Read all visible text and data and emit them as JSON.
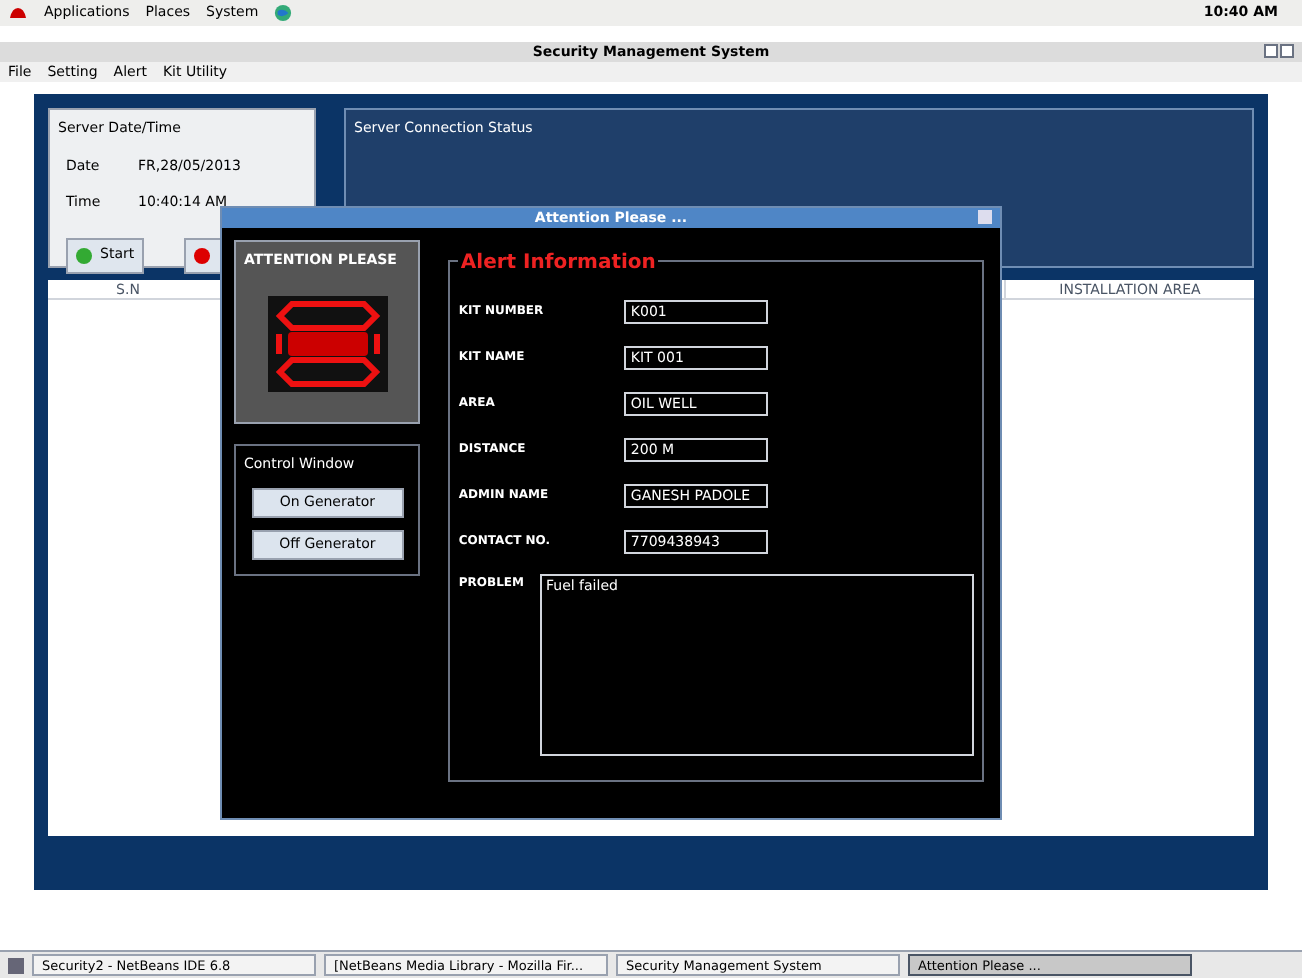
{
  "top_panel": {
    "menus": [
      "Applications",
      "Places",
      "System"
    ],
    "clock": "10:40 AM"
  },
  "window": {
    "title": "Security Management System",
    "menu": [
      "File",
      "Setting",
      "Alert",
      "Kit Utility"
    ]
  },
  "server_panel": {
    "title": "Server Date/Time",
    "rows": [
      {
        "label": "Date",
        "value": "FR,28/05/2013"
      },
      {
        "label": "Time",
        "value": "10:40:14 AM"
      }
    ],
    "start_button": "Start"
  },
  "connection_panel": {
    "title": "Server Connection Status"
  },
  "table": {
    "columns": [
      "S.N",
      "INSTALLATION AREA"
    ]
  },
  "dialog": {
    "title": "Attention Please ...",
    "alert_panel_title": "ATTENTION PLEASE",
    "control_title": "Control Window",
    "buttons": [
      "On Generator",
      "Off Generator"
    ],
    "info_title": "Alert Information",
    "fields": [
      {
        "label": "KIT NUMBER",
        "value": "K001"
      },
      {
        "label": "KIT NAME",
        "value": "KIT 001"
      },
      {
        "label": "AREA",
        "value": "OIL WELL"
      },
      {
        "label": "DISTANCE",
        "value": "200 M"
      },
      {
        "label": "ADMIN NAME",
        "value": "GANESH PADOLE"
      },
      {
        "label": "CONTACT NO.",
        "value": "7709438943"
      }
    ],
    "problem_label": "PROBLEM",
    "problem": "Fuel failed"
  },
  "taskbar": [
    {
      "label": "Security2 - NetBeans IDE 6.8",
      "selected": false
    },
    {
      "label": "[NetBeans Media Library - Mozilla Fir...",
      "selected": false
    },
    {
      "label": "Security Management System",
      "selected": false
    },
    {
      "label": "Attention Please ...",
      "selected": true
    }
  ]
}
